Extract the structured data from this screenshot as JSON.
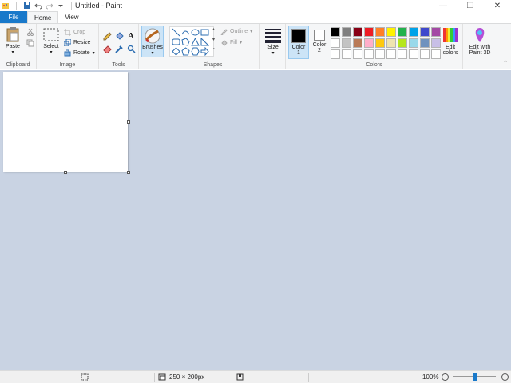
{
  "window": {
    "title": "Untitled - Paint",
    "controls": {
      "minimize": "—",
      "restore": "❐",
      "close": "✕"
    }
  },
  "tabs": [
    {
      "label": "File"
    },
    {
      "label": "Home"
    },
    {
      "label": "View"
    }
  ],
  "ribbon": {
    "clipboard": {
      "paste_label": "Paste",
      "group_label": "Clipboard"
    },
    "image": {
      "select_label": "Select",
      "crop_label": "Crop",
      "resize_label": "Resize",
      "rotate_label": "Rotate",
      "group_label": "Image"
    },
    "tools": {
      "group_label": "Tools",
      "text_tool": "A"
    },
    "brushes": {
      "label": "Brushes"
    },
    "shapes": {
      "outline_label": "Outline",
      "fill_label": "Fill",
      "group_label": "Shapes"
    },
    "size": {
      "label": "Size"
    },
    "colors": {
      "color1_label": "Color",
      "color1_num": "1",
      "color2_label": "Color",
      "color2_num": "2",
      "edit_colors_label": "Edit",
      "edit_colors_label2": "colors",
      "group_label": "Colors",
      "color1": "#000000",
      "color2": "#ffffff",
      "palette": [
        "#000000",
        "#7f7f7f",
        "#880015",
        "#ed1c24",
        "#ff7f27",
        "#fff200",
        "#22b14c",
        "#00a2e8",
        "#3f48cc",
        "#a349a4",
        "#ffffff",
        "#c3c3c3",
        "#b97a57",
        "#ffaec9",
        "#ffc90e",
        "#efe4b0",
        "#b5e61d",
        "#99d9ea",
        "#7092be",
        "#c8bfe7",
        "#ffffff",
        "#ffffff",
        "#ffffff",
        "#ffffff",
        "#ffffff",
        "#ffffff",
        "#ffffff",
        "#ffffff",
        "#ffffff",
        "#ffffff"
      ]
    },
    "paint3d": {
      "label": "Edit with",
      "label2": "Paint 3D"
    }
  },
  "statusbar": {
    "size": "250 × 200px",
    "zoom": "100%",
    "zoom_out": "−",
    "zoom_in": "+"
  }
}
